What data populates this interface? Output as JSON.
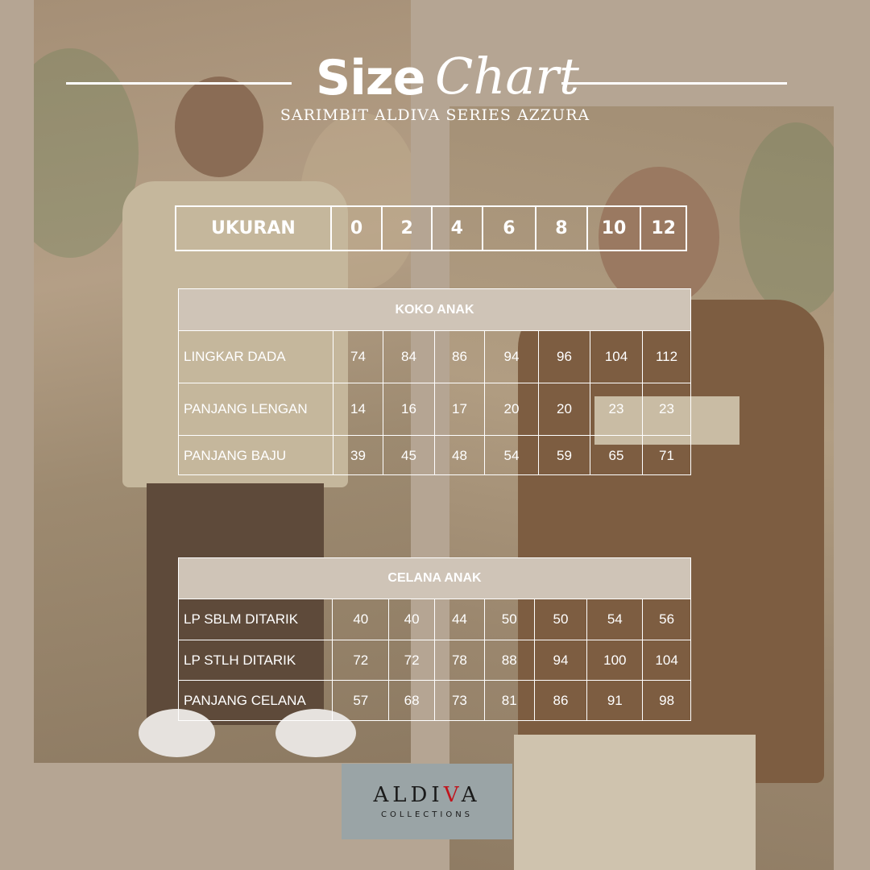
{
  "header": {
    "title_size": "Size",
    "title_chart": "Chart",
    "subtitle": "SARIMBIT ALDIVA SERIES AZZURA"
  },
  "size_header": {
    "label": "UKURAN",
    "sizes": [
      "0",
      "2",
      "4",
      "6",
      "8",
      "10",
      "12"
    ]
  },
  "koko": {
    "title": "KOKO ANAK",
    "rows": [
      {
        "label": "LINGKAR DADA",
        "values": [
          "74",
          "84",
          "86",
          "94",
          "96",
          "104",
          "112"
        ]
      },
      {
        "label": "PANJANG LENGAN",
        "values": [
          "14",
          "16",
          "17",
          "20",
          "20",
          "23",
          "23"
        ]
      },
      {
        "label": "PANJANG BAJU",
        "values": [
          "39",
          "45",
          "48",
          "54",
          "59",
          "65",
          "71"
        ]
      }
    ]
  },
  "celana": {
    "title": "CELANA ANAK",
    "rows": [
      {
        "label": "LP SBLM DITARIK",
        "values": [
          "40",
          "40",
          "44",
          "50",
          "50",
          "54",
          "56"
        ]
      },
      {
        "label": "LP STLH DITARIK",
        "values": [
          "72",
          "72",
          "78",
          "88",
          "94",
          "100",
          "104"
        ]
      },
      {
        "label": "PANJANG CELANA",
        "values": [
          "57",
          "68",
          "73",
          "81",
          "86",
          "91",
          "98"
        ]
      }
    ]
  },
  "logo": {
    "brand_a": "ALDI",
    "brand_v": "V",
    "brand_b": "A",
    "sub": "COLLECTIONS"
  },
  "colors": {
    "background": "#b5a593",
    "header_fill": "#cfc4b7",
    "logo_bg": "#9aa4a6",
    "logo_accent": "#c0141c"
  }
}
